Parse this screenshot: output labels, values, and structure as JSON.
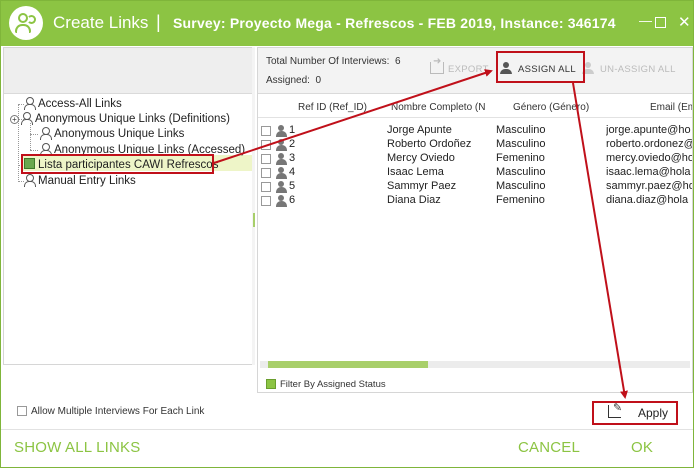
{
  "window": {
    "title": "Create Links",
    "separator": "|",
    "survey": "Survey: Proyecto Mega - Refrescos - FEB 2019, Instance: 346174",
    "accent_color": "#8cc443",
    "annotation_color": "#c0101a"
  },
  "tree": {
    "items": [
      {
        "label": "Access-All Links",
        "icon": "user-icon"
      },
      {
        "label": "Anonymous Unique Links (Definitions)",
        "icon": "user-icon"
      },
      {
        "label": "Anonymous Unique Links",
        "icon": "user-icon"
      },
      {
        "label": "Anonymous Unique Links (Accessed)",
        "icon": "user-icon"
      },
      {
        "label": "Lista participantes CAWI Refrescos",
        "icon": "database-icon"
      },
      {
        "label": "Manual Entry Links",
        "icon": "user-icon"
      }
    ],
    "expander_symbol": "+"
  },
  "stats": {
    "total_label": "Total Number Of Interviews:",
    "total_value": "6",
    "assigned_label": "Assigned:",
    "assigned_value": "0"
  },
  "toolbar": {
    "export_label": "EXPORT",
    "assign_all_label": "ASSIGN ALL",
    "unassign_all_label": "UN-ASSIGN ALL"
  },
  "grid": {
    "columns": [
      "Ref ID (Ref_ID)",
      "Nombre Completo (N",
      "Género (Género)",
      "Email (Em"
    ],
    "rows": [
      {
        "id": "1",
        "name": "Jorge Apunte",
        "gender": "Masculino",
        "email": "jorge.apunte@ho"
      },
      {
        "id": "2",
        "name": "Roberto Ordoñez",
        "gender": "Masculino",
        "email": "roberto.ordonez@"
      },
      {
        "id": "3",
        "name": "Mercy Oviedo",
        "gender": "Femenino",
        "email": "mercy.oviedo@ho"
      },
      {
        "id": "4",
        "name": "Isaac Lema",
        "gender": "Masculino",
        "email": "isaac.lema@hola"
      },
      {
        "id": "5",
        "name": "Sammyr Paez",
        "gender": "Masculino",
        "email": "sammyr.paez@ho"
      },
      {
        "id": "6",
        "name": "Diana Diaz",
        "gender": "Femenino",
        "email": "diana.diaz@hola"
      }
    ]
  },
  "filter": {
    "label": "Filter By Assigned Status"
  },
  "options": {
    "allow_multiple_label": "Allow Multiple Interviews For Each Link"
  },
  "actions": {
    "apply_label": "Apply",
    "show_all_label": "SHOW ALL LINKS",
    "cancel_label": "CANCEL",
    "ok_label": "OK"
  },
  "window_controls": {
    "minimize": "—",
    "close": "✕"
  }
}
